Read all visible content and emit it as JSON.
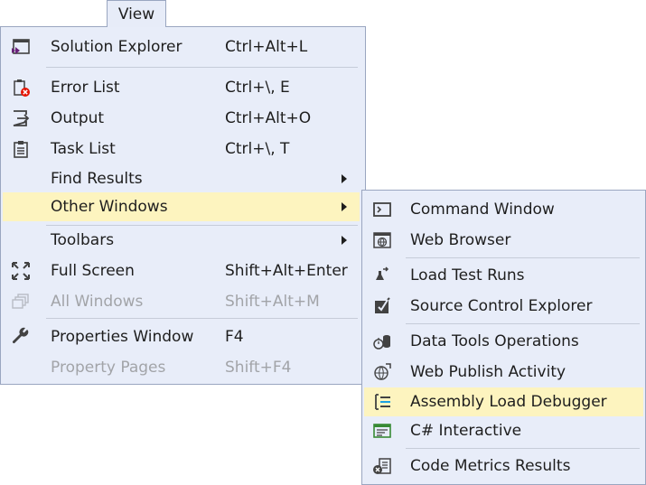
{
  "header": {
    "view_label": "View"
  },
  "menu": {
    "items": [
      {
        "label": "Solution Explorer",
        "shortcut": "Ctrl+Alt+L",
        "icon": "solution-explorer-icon"
      },
      {
        "label": "Error List",
        "shortcut": "Ctrl+\\, E",
        "icon": "error-list-icon"
      },
      {
        "label": "Output",
        "shortcut": "Ctrl+Alt+O",
        "icon": "output-icon"
      },
      {
        "label": "Task List",
        "shortcut": "Ctrl+\\, T",
        "icon": "task-list-icon"
      },
      {
        "label": "Find Results",
        "shortcut": "",
        "has_submenu": true
      },
      {
        "label": "Other Windows",
        "shortcut": "",
        "has_submenu": true,
        "highlighted": true
      },
      {
        "label": "Toolbars",
        "shortcut": "",
        "has_submenu": true
      },
      {
        "label": "Full Screen",
        "shortcut": "Shift+Alt+Enter",
        "icon": "full-screen-icon"
      },
      {
        "label": "All Windows",
        "shortcut": "Shift+Alt+M",
        "icon": "all-windows-icon",
        "disabled": true
      },
      {
        "label": "Properties Window",
        "shortcut": "F4",
        "icon": "wrench-icon"
      },
      {
        "label": "Property Pages",
        "shortcut": "Shift+F4",
        "disabled": true
      }
    ]
  },
  "submenu": {
    "items": [
      {
        "label": "Command Window",
        "icon": "command-window-icon"
      },
      {
        "label": "Web Browser",
        "icon": "web-browser-icon"
      },
      {
        "label": "Load Test Runs",
        "icon": "load-test-runs-icon"
      },
      {
        "label": "Source Control Explorer",
        "icon": "source-control-icon"
      },
      {
        "label": "Data Tools Operations",
        "icon": "data-tools-icon"
      },
      {
        "label": "Web Publish Activity",
        "icon": "web-publish-icon"
      },
      {
        "label": "Assembly Load Debugger",
        "icon": "assembly-load-debugger-icon",
        "highlighted": true
      },
      {
        "label": "C# Interactive",
        "icon": "csharp-interactive-icon"
      },
      {
        "label": "Code Metrics Results",
        "icon": "code-metrics-icon"
      }
    ]
  },
  "colors": {
    "menu_bg": "#e8edf9",
    "highlight": "#fdf4bf",
    "border": "#9aa6c0",
    "disabled_text": "#a2a4a8",
    "vs_purple": "#68217a",
    "error_red": "#e51400",
    "accent_blue": "#1ba1e2"
  }
}
